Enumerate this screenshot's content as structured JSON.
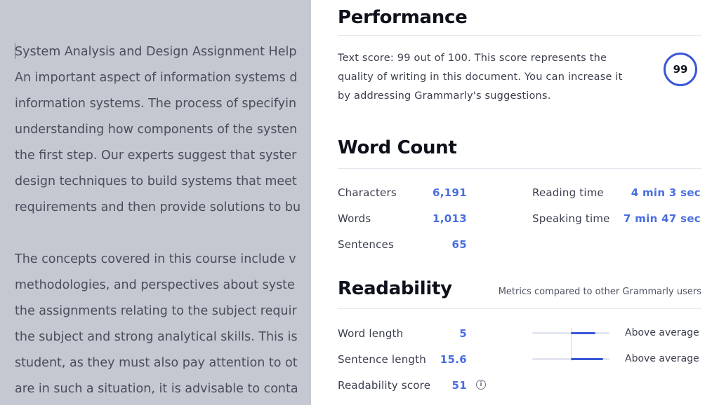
{
  "document": {
    "lines": [
      "System Analysis and Design Assignment Help",
      "An important aspect of information systems d",
      "information systems. The process of specifyin",
      "understanding how components of the systen",
      "the first step. Our experts suggest that syster",
      "design techniques to build systems that meet",
      "requirements and then provide solutions to bu",
      "",
      "The concepts covered in this course include v",
      "methodologies, and perspectives about syste",
      "the assignments relating to the subject requir",
      "the subject and strong analytical skills. This is",
      "student, as they must also pay attention to ot",
      "are in such a situation, it is advisable to conta"
    ]
  },
  "performance": {
    "title": "Performance",
    "text": "Text score: 99 out of 100. This score represents the quality of writing in this document. You can increase it by addressing Grammarly's suggestions.",
    "score": "99"
  },
  "word_count": {
    "title": "Word Count",
    "characters_label": "Characters",
    "characters_value": "6,191",
    "words_label": "Words",
    "words_value": "1,013",
    "sentences_label": "Sentences",
    "sentences_value": "65",
    "reading_time_label": "Reading time",
    "reading_time_value": "4 min 3 sec",
    "speaking_time_label": "Speaking time",
    "speaking_time_value": "7 min 47 sec"
  },
  "readability": {
    "title": "Readability",
    "note": "Metrics compared to other Grammarly users",
    "word_length_label": "Word length",
    "word_length_value": "5",
    "word_length_rating": "Above average",
    "sentence_length_label": "Sentence length",
    "sentence_length_value": "15.6",
    "sentence_length_rating": "Above average",
    "readability_score_label": "Readability score",
    "readability_score_value": "51",
    "info_icon": "info-icon"
  },
  "colors": {
    "accent": "#3a57d8",
    "value_blue": "#4a6ee0",
    "overlay": "#c5c7d1"
  }
}
